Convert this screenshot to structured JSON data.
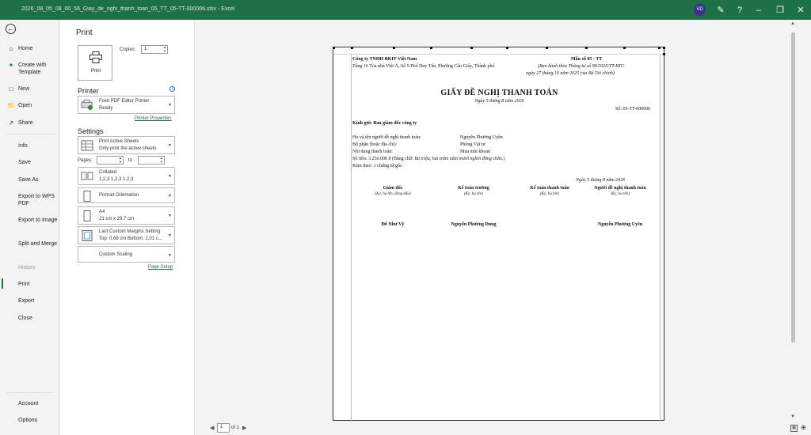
{
  "titlebar": {
    "filename": "2026_08_05_08_00_56_Giay_de_nghi_thanh_toan_05_TT_05-TT-000006.xlsx  -  Excel",
    "user_initials": "VD"
  },
  "nav": {
    "home": "Home",
    "create_template": "Create with Template",
    "new": "New",
    "open": "Open",
    "share": "Share",
    "info": "Info",
    "save": "Save",
    "save_as": "Save As",
    "export_wps": "Export to WPS PDF",
    "export_image": "Export to Image",
    "split_merge": "Split and Merge",
    "history": "History",
    "print": "Print",
    "export": "Export",
    "close": "Close",
    "account": "Account",
    "options": "Options"
  },
  "print_panel": {
    "title": "Print",
    "print_button": "Print",
    "copies_label": "Copies:",
    "copies_value": "1",
    "printer_section": "Printer",
    "printer_name": "Foxit PDF Editor Printer",
    "printer_status": "Ready",
    "printer_properties": "Printer Properties",
    "settings_section": "Settings",
    "what_line1": "Print Active Sheets",
    "what_line2": "Only print the active sheets",
    "pages_label": "Pages:",
    "pages_to": "to",
    "collate_line1": "Collated",
    "collate_line2": "1,2,3    1,2,3    1,2,3",
    "orientation": "Portrait Orientation",
    "paper_line1": "A4",
    "paper_line2": "21 cm x 29,7 cm",
    "margins_line1": "Last Custom Margins Setting",
    "margins_line2": "Top: 0,66 cm Bottom: 2,01 c...",
    "scaling": "Custom Scaling",
    "page_setup": "Page Setup"
  },
  "document": {
    "company": "Công ty TNHH BKIT Việt Nam",
    "address": "Tầng 16 Tòa nhà Việt Á, Số 9 Phố Duy Tân, Phường Cầu Giấy, Thành phố",
    "form_no": "Mẫu số 05 - TT",
    "form_ref1": "(Ban hành theo Thông tư số 99/2025/TT-BTC",
    "form_ref2": "ngày 27 tháng 10 năm 2025 của Bộ Tài chính)",
    "heading": "GIẤY ĐỀ NGHỊ THANH TOÁN",
    "date_line": "Ngày 5 tháng 8 năm 2026",
    "doc_no": "Số: 05-TT-000006",
    "addressee": "Kính gửi: Ban giám đốc công ty",
    "f1_label": "Họ và tên người đề nghị thanh toán:",
    "f1_value": "Nguyễn Phương Uyên",
    "f2_label": "Bộ phận (hoặc địa chỉ):",
    "f2_value": "Phòng Vật tư",
    "f3_label": "Nội dung thanh toán:",
    "f3_value": "Mua mũi khoan",
    "amount_text": "Số tiền: 3.250.000 đ (Bằng chữ: ",
    "amount_words": "Ba triệu, hai trăm năm mươi nghìn đồng chẵn.",
    "amount_close": ")",
    "attach": "Kèm theo: 1 chứng từ gốc.",
    "sign_date": "Ngày 5 tháng 8 năm 2026",
    "sig1_title": "Giám đốc",
    "sig1_note": "(Ký, họ tên, đóng dấu)",
    "sig2_title": "Kế toán trưởng",
    "sig2_note": "(Ký, họ tên)",
    "sig3_title": "Kế toán thanh toán",
    "sig3_note": "(Ký, họ tên)",
    "sig4_title": "Người đề nghị thanh toán",
    "sig4_note": "(Ký, họ tên)",
    "name1": "Đỗ Như Vỹ",
    "name2": "Nguyễn Phương Dung",
    "name4": "Nguyễn Phương Uyên"
  },
  "pager": {
    "current": "1",
    "of_total": "of 1"
  }
}
